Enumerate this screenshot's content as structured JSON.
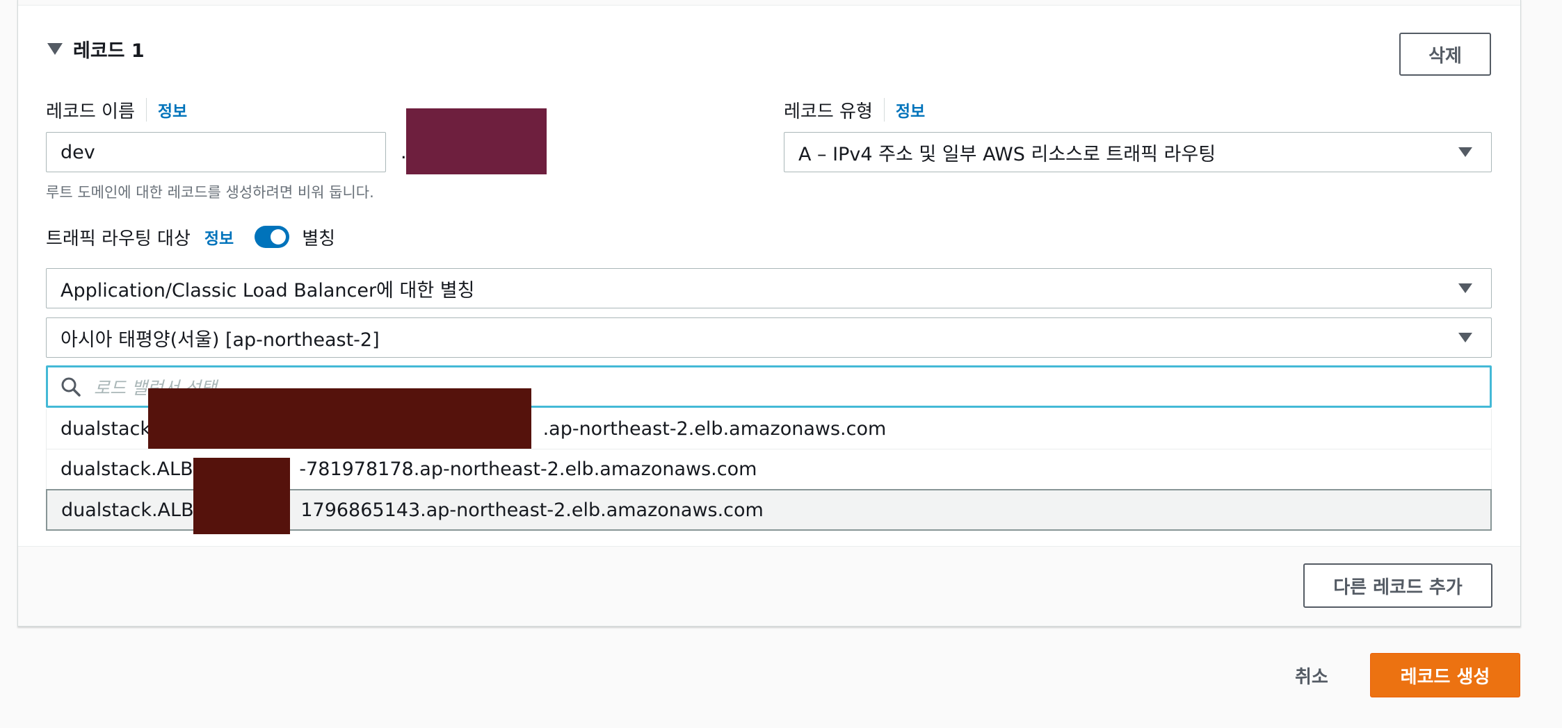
{
  "record": {
    "title": "레코드 1",
    "delete_label": "삭제",
    "name_label": "레코드 이름",
    "name_info": "정보",
    "name_value": "dev",
    "name_hint": "루트 도메인에 대한 레코드를 생성하려면 비워 둡니다.",
    "domain_suffix": ".",
    "type_label": "레코드 유형",
    "type_info": "정보",
    "type_value": "A – IPv4 주소 및 일부 AWS 리소스로 트래픽 라우팅"
  },
  "routing": {
    "label": "트래픽 라우팅 대상",
    "info": "정보",
    "alias_toggle_label": "별칭",
    "alias_on": true,
    "endpoint_value": "Application/Classic Load Balancer에 대한 별칭",
    "region_value": "아시아 태평양(서울) [ap-northeast-2]",
    "search_placeholder": "로드 밸런서 선택"
  },
  "load_balancers": [
    {
      "prefix": "dualstack.",
      "suffix": ".ap-northeast-2.elb.amazonaws.com"
    },
    {
      "prefix": "dualstack.ALB-",
      "suffix": "-781978178.ap-northeast-2.elb.amazonaws.com"
    },
    {
      "prefix": "dualstack.ALB-",
      "suffix": "1796865143.ap-northeast-2.elb.amazonaws.com"
    }
  ],
  "footer": {
    "add_record_label": "다른 레코드 추가",
    "cancel_label": "취소",
    "create_label": "레코드 생성"
  },
  "colors": {
    "accent": "#0073bb",
    "primary_button": "#ec7211",
    "focus_border": "#44b9d6",
    "redaction": "#55120c",
    "domain_redaction": "#6e1f3e"
  }
}
